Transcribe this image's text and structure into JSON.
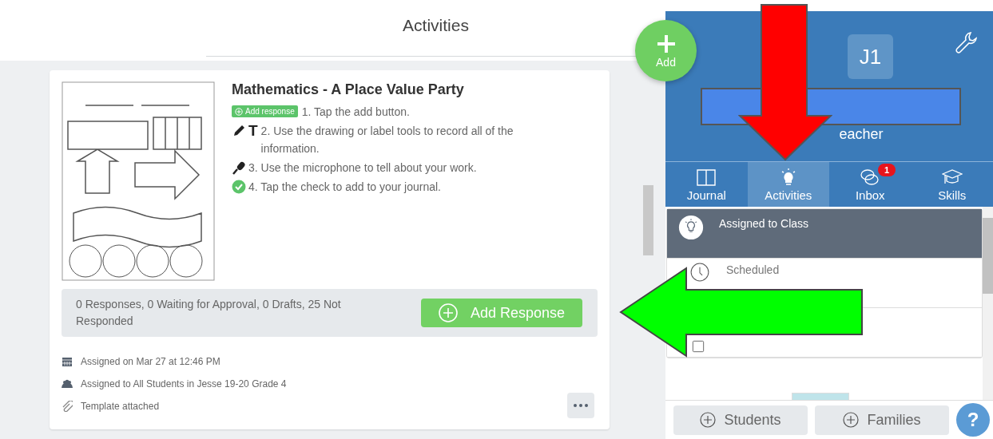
{
  "header": {
    "title": "Activities"
  },
  "add_button": {
    "label": "Add"
  },
  "activity": {
    "title": "Mathematics - A Place Value Party",
    "instructions": [
      {
        "kind": "badge",
        "badge": "Add response",
        "text": "1. Tap the add button."
      },
      {
        "kind": "tools",
        "tool_letter": "T",
        "text": "2. Use the drawing or label tools to record all of the information."
      },
      {
        "kind": "mic",
        "text": "3. Use the microphone to tell about your work."
      },
      {
        "kind": "check",
        "text": "4. Tap the check to add to your journal."
      }
    ],
    "summary": "0 Responses, 0 Waiting for Approval, 0 Drafts, 25 Not Responded",
    "action": "Add Response",
    "meta": [
      {
        "kind": "calendar",
        "text": "Assigned on Mar 27 at 12:46 PM"
      },
      {
        "kind": "group",
        "text": "Assigned to All Students in Jesse 19-20 Grade 4"
      },
      {
        "kind": "clip",
        "text": "Template attached"
      }
    ]
  },
  "profile": {
    "avatar": "J1",
    "role": "eacher"
  },
  "tabs": [
    {
      "kind": "book",
      "label": "Journal",
      "selected": false
    },
    {
      "kind": "bulb",
      "label": "Activities",
      "selected": true
    },
    {
      "kind": "chat",
      "label": "Inbox",
      "selected": false,
      "badge": "1"
    },
    {
      "kind": "cap",
      "label": "Skills",
      "selected": false
    }
  ],
  "list": [
    {
      "kind": "bulb",
      "label": "Assigned to Class",
      "selected": true
    },
    {
      "kind": "clock",
      "label": "Scheduled",
      "selected": false
    },
    {
      "kind": "square",
      "selected": false
    }
  ],
  "footer_buttons": [
    "Students",
    "Families"
  ],
  "help": "?"
}
